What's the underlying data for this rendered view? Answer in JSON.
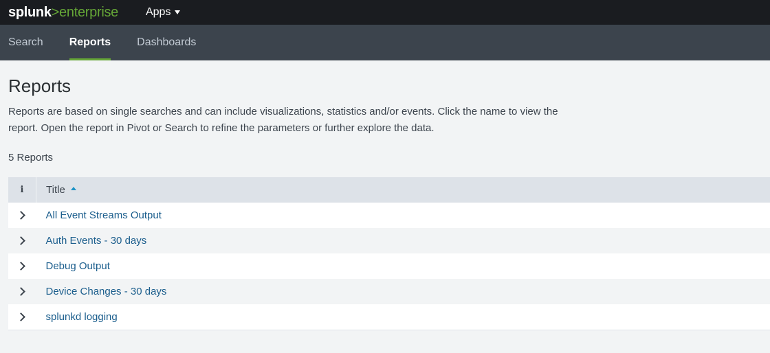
{
  "header": {
    "logo_brand": "splunk",
    "logo_separator": ">",
    "logo_product": "enterprise",
    "apps_label": "Apps"
  },
  "nav": {
    "tabs": [
      {
        "label": "Search",
        "active": false
      },
      {
        "label": "Reports",
        "active": true
      },
      {
        "label": "Dashboards",
        "active": false
      }
    ]
  },
  "main": {
    "title": "Reports",
    "description": "Reports are based on single searches and can include visualizations, statistics and/or events. Click the name to view the report. Open the report in Pivot or Search to refine the parameters or further explore the data.",
    "count_label": "5 Reports"
  },
  "table": {
    "info_header": "i",
    "title_header": "Title",
    "rows": [
      {
        "title": "All Event Streams Output"
      },
      {
        "title": "Auth Events - 30 days"
      },
      {
        "title": "Debug Output"
      },
      {
        "title": "Device Changes - 30 days"
      },
      {
        "title": "splunkd logging"
      }
    ]
  },
  "colors": {
    "topbar_bg": "#1a1c20",
    "navbar_bg": "#3c444d",
    "accent_green": "#65a637",
    "link_blue": "#1a5d8c",
    "page_bg": "#f2f4f5"
  }
}
